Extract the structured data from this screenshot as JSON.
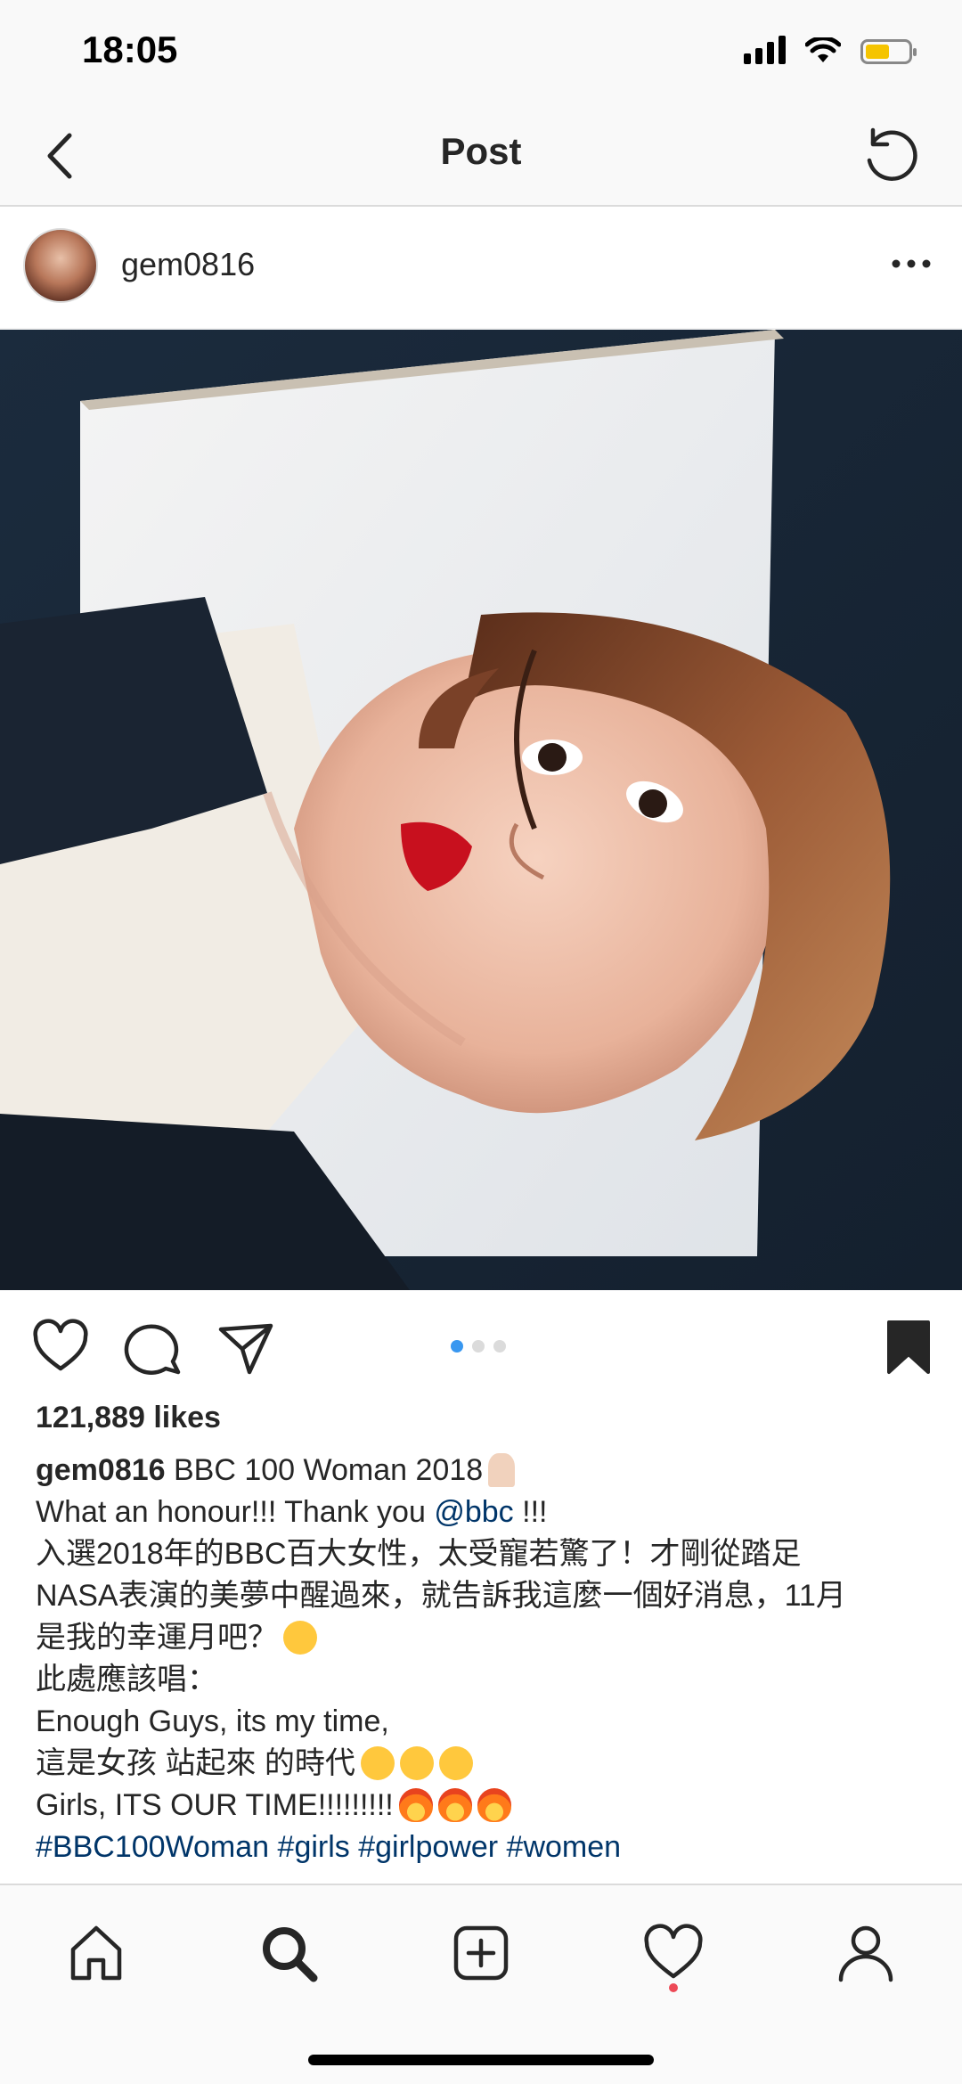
{
  "status_bar": {
    "time": "18:05"
  },
  "nav": {
    "title": "Post"
  },
  "post": {
    "username": "gem0816",
    "image_alt": "Selfie photo",
    "carousel": {
      "count": 3,
      "active": 1
    },
    "likes": "121,889 likes",
    "caption": {
      "username": "gem0816",
      "line1": "BBC 100 Woman 2018",
      "line2_prefix": "What an honour!!! Thank you",
      "line2_mention": "@bbc",
      "line2_suffix": "!!!",
      "line3": "入選2018年的BBC百大女性，太受寵若驚了！才剛從踏足",
      "line4": "NASA表演的美夢中醒過來，就告訴我這麼一個好消息，11月",
      "line5": "是我的幸運月吧？",
      "line6": "此處應該唱：",
      "line7": "Enough Guys, its my time,",
      "line8": "這是女孩 站起來 的時代",
      "line9": "Girls, ITS OUR TIME!!!!!!!!!",
      "hashtags": [
        "#BBC100Woman",
        "#girls",
        "#girlpower",
        "#women"
      ]
    }
  },
  "tabbar": {
    "items": [
      "home-icon",
      "search-icon",
      "new-post-icon",
      "activity-icon",
      "profile-icon"
    ]
  },
  "colors": {
    "accent": "#3897f0",
    "link": "#003569",
    "notification": "#ed4956"
  }
}
